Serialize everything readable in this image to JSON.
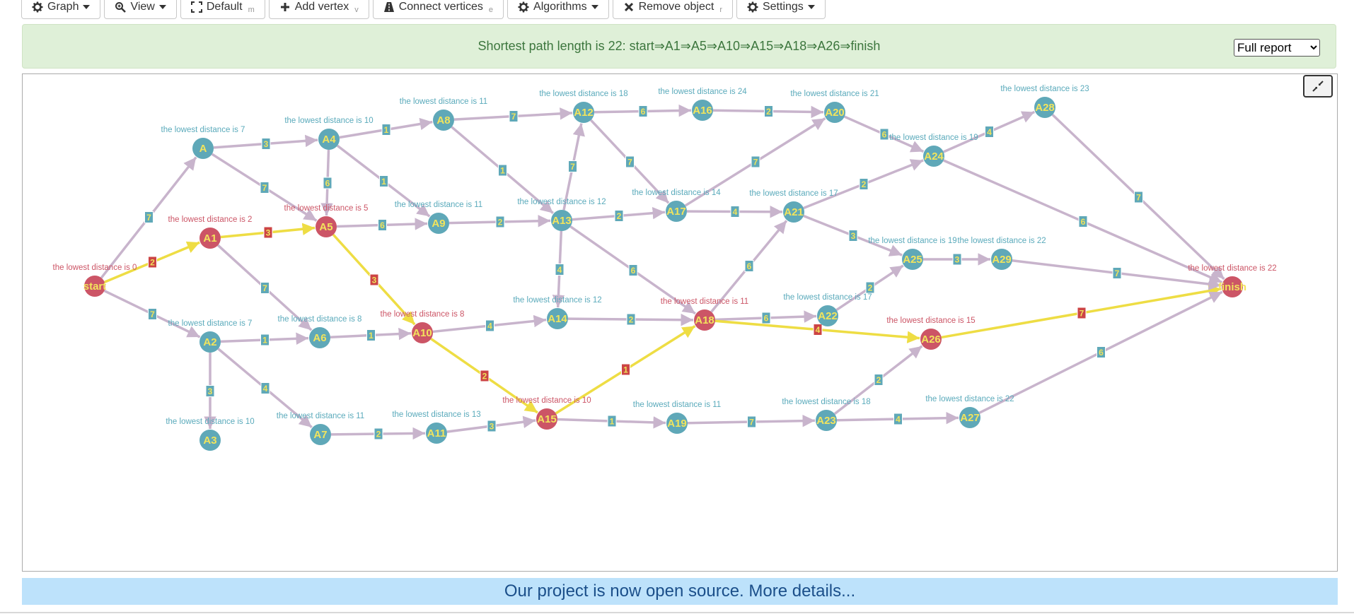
{
  "toolbar": {
    "graph": "Graph",
    "view": "View",
    "default": "Default",
    "default_hotkey": "m",
    "add_vertex": "Add vertex",
    "add_vertex_hotkey": "v",
    "connect_vertices": "Connect vertices",
    "connect_vertices_hotkey": "e",
    "algorithms": "Algorithms",
    "remove_object": "Remove object",
    "remove_object_hotkey": "r",
    "settings": "Settings"
  },
  "banner": {
    "message": "Shortest path length is 22: start⇒A1⇒A5⇒A10⇒A15⇒A18⇒A26⇒finish",
    "report_select": "Full report"
  },
  "footer": {
    "text": "Our project is now open source. More details..."
  },
  "colors": {
    "node_normal": "#5fa8b8",
    "node_path": "#cc5566",
    "edge_normal": "#c8b4cc",
    "edge_path": "#eedd44",
    "label_normal": "#5aaabb",
    "label_path": "#cc5566",
    "weight_box_normal": "#5fa8b8",
    "weight_box_path": "#cc4444"
  },
  "graph": {
    "nodes": [
      {
        "id": "start",
        "label": "start",
        "dist": "the lowest distance is 0",
        "path": true
      },
      {
        "id": "A",
        "label": "A",
        "dist": "the lowest distance is 7",
        "path": false
      },
      {
        "id": "A1",
        "label": "A1",
        "dist": "the lowest distance is 2",
        "path": true
      },
      {
        "id": "A2",
        "label": "A2",
        "dist": "the lowest distance is 7",
        "path": false
      },
      {
        "id": "A3",
        "label": "A3",
        "dist": "the lowest distance is 10",
        "path": false
      },
      {
        "id": "A4",
        "label": "A4",
        "dist": "the lowest distance is 10",
        "path": false
      },
      {
        "id": "A5",
        "label": "A5",
        "dist": "the lowest distance is 5",
        "path": true
      },
      {
        "id": "A6",
        "label": "A6",
        "dist": "the lowest distance is 8",
        "path": false
      },
      {
        "id": "A7",
        "label": "A7",
        "dist": "the lowest distance is 11",
        "path": false
      },
      {
        "id": "A8",
        "label": "A8",
        "dist": "the lowest distance is 11",
        "path": false
      },
      {
        "id": "A9",
        "label": "A9",
        "dist": "the lowest distance is 11",
        "path": false
      },
      {
        "id": "A10",
        "label": "A10",
        "dist": "the lowest distance is 8",
        "path": true
      },
      {
        "id": "A11",
        "label": "A11",
        "dist": "the lowest distance is 13",
        "path": false
      },
      {
        "id": "A12",
        "label": "A12",
        "dist": "the lowest distance is 18",
        "path": false
      },
      {
        "id": "A13",
        "label": "A13",
        "dist": "the lowest distance is 12",
        "path": false
      },
      {
        "id": "A14",
        "label": "A14",
        "dist": "the lowest distance is 12",
        "path": false
      },
      {
        "id": "A15",
        "label": "A15",
        "dist": "the lowest distance is 10",
        "path": true
      },
      {
        "id": "A16",
        "label": "A16",
        "dist": "the lowest distance is 24",
        "path": false
      },
      {
        "id": "A17",
        "label": "A17",
        "dist": "the lowest distance is 14",
        "path": false
      },
      {
        "id": "A18",
        "label": "A18",
        "dist": "the lowest distance is 11",
        "path": true
      },
      {
        "id": "A19",
        "label": "A19",
        "dist": "the lowest distance is 11",
        "path": false
      },
      {
        "id": "A20",
        "label": "A20",
        "dist": "the lowest distance is 21",
        "path": false
      },
      {
        "id": "A21",
        "label": "A21",
        "dist": "the lowest distance is 17",
        "path": false
      },
      {
        "id": "A22",
        "label": "A22",
        "dist": "the lowest distance is 17",
        "path": false
      },
      {
        "id": "A23",
        "label": "A23",
        "dist": "the lowest distance is 18",
        "path": false
      },
      {
        "id": "A24",
        "label": "A24",
        "dist": "the lowest distance is 19",
        "path": false
      },
      {
        "id": "A25",
        "label": "A25",
        "dist": "the lowest distance is 19",
        "path": false
      },
      {
        "id": "A26",
        "label": "A26",
        "dist": "the lowest distance is 15",
        "path": true
      },
      {
        "id": "A27",
        "label": "A27",
        "dist": "the lowest distance is 22",
        "path": false
      },
      {
        "id": "A28",
        "label": "A28",
        "dist": "the lowest distance is 23",
        "path": false
      },
      {
        "id": "A29",
        "label": "A29",
        "dist": "the lowest distance is 22",
        "path": false
      },
      {
        "id": "finish",
        "label": "finish",
        "dist": "the lowest distance is 22",
        "path": true
      }
    ],
    "edges": [
      {
        "from": "start",
        "to": "A",
        "w": "7",
        "path": false
      },
      {
        "from": "start",
        "to": "A1",
        "w": "2",
        "path": true
      },
      {
        "from": "start",
        "to": "A2",
        "w": "7",
        "path": false
      },
      {
        "from": "A",
        "to": "A4",
        "w": "3",
        "path": false
      },
      {
        "from": "A",
        "to": "A5",
        "w": "7",
        "path": false
      },
      {
        "from": "A1",
        "to": "A5",
        "w": "3",
        "path": true
      },
      {
        "from": "A1",
        "to": "A6",
        "w": "7",
        "path": false
      },
      {
        "from": "A2",
        "to": "A6",
        "w": "1",
        "path": false
      },
      {
        "from": "A2",
        "to": "A3",
        "w": "3",
        "path": false
      },
      {
        "from": "A2",
        "to": "A7",
        "w": "4",
        "path": false
      },
      {
        "from": "A4",
        "to": "A8",
        "w": "1",
        "path": false
      },
      {
        "from": "A4",
        "to": "A5",
        "w": "6",
        "path": false
      },
      {
        "from": "A4",
        "to": "A9",
        "w": "1",
        "path": false
      },
      {
        "from": "A5",
        "to": "A9",
        "w": "6",
        "path": false
      },
      {
        "from": "A5",
        "to": "A10",
        "w": "3",
        "path": true
      },
      {
        "from": "A6",
        "to": "A10",
        "w": "1",
        "path": false
      },
      {
        "from": "A7",
        "to": "A11",
        "w": "2",
        "path": false
      },
      {
        "from": "A8",
        "to": "A12",
        "w": "7",
        "path": false
      },
      {
        "from": "A8",
        "to": "A13",
        "w": "1",
        "path": false
      },
      {
        "from": "A9",
        "to": "A13",
        "w": "2",
        "path": false
      },
      {
        "from": "A10",
        "to": "A14",
        "w": "4",
        "path": false
      },
      {
        "from": "A10",
        "to": "A15",
        "w": "2",
        "path": true
      },
      {
        "from": "A11",
        "to": "A15",
        "w": "3",
        "path": false
      },
      {
        "from": "A12",
        "to": "A16",
        "w": "6",
        "path": false
      },
      {
        "from": "A12",
        "to": "A17",
        "w": "7",
        "path": false
      },
      {
        "from": "A13",
        "to": "A12",
        "w": "7",
        "path": false
      },
      {
        "from": "A13",
        "to": "A17",
        "w": "2",
        "path": false
      },
      {
        "from": "A13",
        "to": "A18",
        "w": "6",
        "path": false
      },
      {
        "from": "A13",
        "to": "A14",
        "w": "4",
        "path": false
      },
      {
        "from": "A14",
        "to": "A18",
        "w": "2",
        "path": false
      },
      {
        "from": "A15",
        "to": "A18",
        "w": "1",
        "path": true
      },
      {
        "from": "A15",
        "to": "A19",
        "w": "1",
        "path": false
      },
      {
        "from": "A16",
        "to": "A20",
        "w": "2",
        "path": false
      },
      {
        "from": "A17",
        "to": "A20",
        "w": "7",
        "path": false
      },
      {
        "from": "A17",
        "to": "A21",
        "w": "4",
        "path": false
      },
      {
        "from": "A18",
        "to": "A21",
        "w": "6",
        "path": false
      },
      {
        "from": "A18",
        "to": "A22",
        "w": "6",
        "path": false
      },
      {
        "from": "A18",
        "to": "A26",
        "w": "4",
        "path": true
      },
      {
        "from": "A19",
        "to": "A23",
        "w": "7",
        "path": false
      },
      {
        "from": "A20",
        "to": "A24",
        "w": "6",
        "path": false
      },
      {
        "from": "A21",
        "to": "A24",
        "w": "2",
        "path": false
      },
      {
        "from": "A21",
        "to": "A25",
        "w": "3",
        "path": false
      },
      {
        "from": "A22",
        "to": "A25",
        "w": "2",
        "path": false
      },
      {
        "from": "A23",
        "to": "A26",
        "w": "2",
        "path": false
      },
      {
        "from": "A23",
        "to": "A27",
        "w": "4",
        "path": false
      },
      {
        "from": "A24",
        "to": "A28",
        "w": "4",
        "path": false
      },
      {
        "from": "A24",
        "to": "finish",
        "w": "6",
        "path": false
      },
      {
        "from": "A25",
        "to": "A29",
        "w": "3",
        "path": false
      },
      {
        "from": "A26",
        "to": "finish",
        "w": "7",
        "path": true
      },
      {
        "from": "A27",
        "to": "finish",
        "w": "6",
        "path": false
      },
      {
        "from": "A28",
        "to": "finish",
        "w": "7",
        "path": false
      },
      {
        "from": "A29",
        "to": "finish",
        "w": "7",
        "path": false
      }
    ]
  }
}
